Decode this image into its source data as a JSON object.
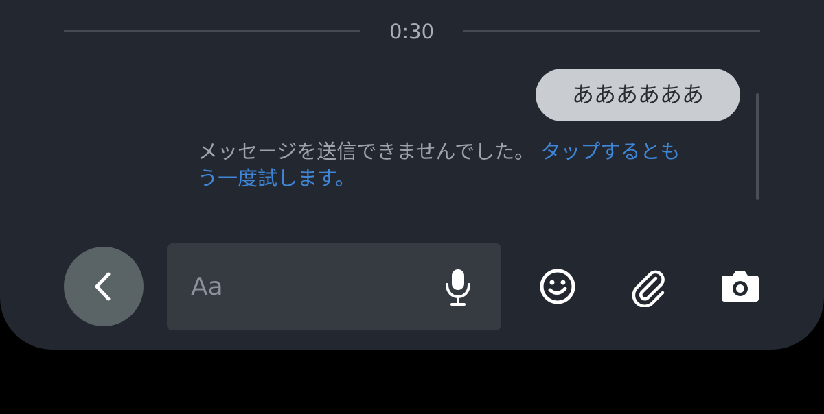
{
  "timestamp": "0:30",
  "message": {
    "text": "ああああああ",
    "error_text": "メッセージを送信できませんでした。",
    "retry_line1": "タップするとも",
    "retry_line2": "う一度試します。"
  },
  "composer": {
    "placeholder": "Aa",
    "back_icon": "chevron-left-icon",
    "mic_icon": "microphone-icon",
    "emoji_icon": "smiley-icon",
    "attach_icon": "paperclip-icon",
    "camera_icon": "camera-icon"
  },
  "colors": {
    "background": "#23272f",
    "bubble": "#c9ccd0",
    "link": "#3f86d8",
    "muted_text": "#9ea2a9"
  }
}
